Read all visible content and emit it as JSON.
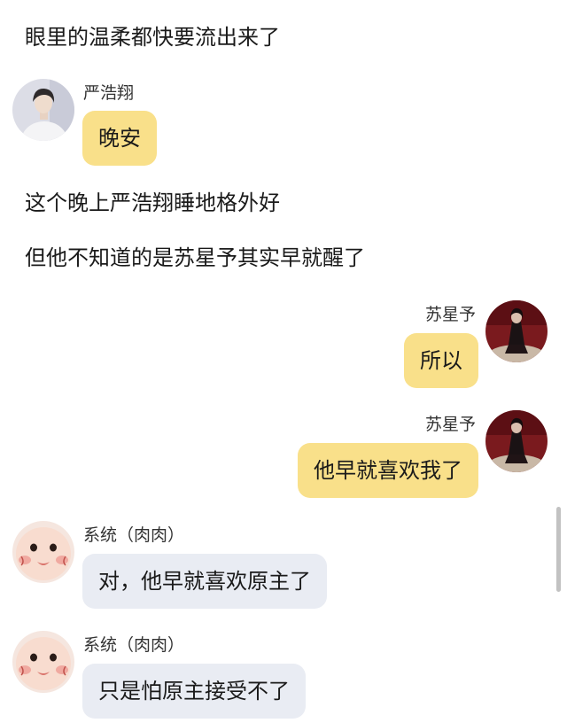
{
  "narration": [
    "眼里的温柔都快要流出来了",
    "这个晚上严浩翔睡地格外好",
    "但他不知道的是苏星予其实早就醒了"
  ],
  "messages": [
    {
      "sender": "严浩翔",
      "text": "晚安",
      "side": "left"
    },
    {
      "sender": "苏星予",
      "text": "所以",
      "side": "right"
    },
    {
      "sender": "苏星予",
      "text": "他早就喜欢我了",
      "side": "right"
    },
    {
      "sender": "系统（肉肉）",
      "text": "对，他早就喜欢原主了",
      "side": "left"
    },
    {
      "sender": "系统（肉肉）",
      "text": "只是怕原主接受不了",
      "side": "left"
    }
  ],
  "colors": {
    "bubble_yellow": "#f9e08a",
    "bubble_gray": "#e9ecf3",
    "background": "#ffffff"
  },
  "icons": {
    "avatar_yan": "avatar-yan-haoxiang-icon",
    "avatar_su": "avatar-su-xingyu-icon",
    "avatar_system": "avatar-system-rourou-icon"
  }
}
